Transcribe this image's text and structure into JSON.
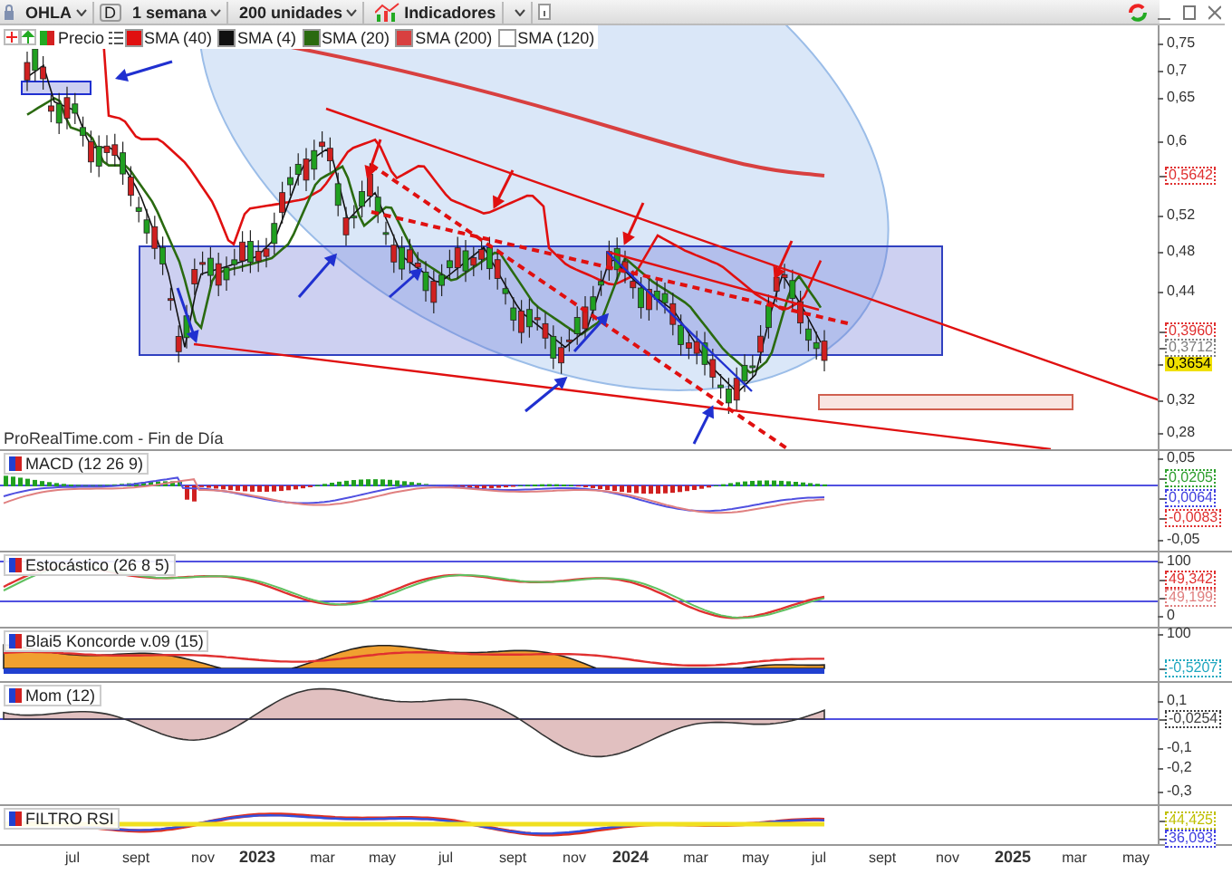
{
  "toolbar": {
    "symbol": "OHLA",
    "mode": "D",
    "period": "1 semana",
    "units": "200 unidades",
    "indicators": "Indicadores"
  },
  "legend": [
    {
      "label": "Precio",
      "color": "#d42020"
    },
    {
      "label": "SMA (40)",
      "color": "#e01010"
    },
    {
      "label": "SMA (4)",
      "color": "#101010"
    },
    {
      "label": "SMA (20)",
      "color": "#2a6a10"
    },
    {
      "label": "SMA (200)",
      "color": "#d84040"
    },
    {
      "label": "SMA (120)",
      "color": "#ffffff"
    }
  ],
  "price_panel": {
    "source": "ProRealTime.com - Fin de Día",
    "axis_labels": [
      {
        "text": "0,75",
        "kind": "tick"
      },
      {
        "text": "0,7",
        "kind": "tick"
      },
      {
        "text": "0,65",
        "kind": "tick"
      },
      {
        "text": "0,6",
        "kind": "tick"
      },
      {
        "text": "0,5642",
        "kind": "marker",
        "color": "#e03030"
      },
      {
        "text": "0,52",
        "kind": "tick"
      },
      {
        "text": "0,48",
        "kind": "tick"
      },
      {
        "text": "0,44",
        "kind": "tick"
      },
      {
        "text": "0,3960",
        "kind": "marker",
        "color": "#e03030"
      },
      {
        "text": "0,3712",
        "kind": "marker",
        "color": "#808080"
      },
      {
        "text": "0,3654",
        "kind": "current",
        "color": "#f0e000"
      },
      {
        "text": "0,32",
        "kind": "tick"
      },
      {
        "text": "0,28",
        "kind": "tick"
      }
    ]
  },
  "panels": [
    {
      "kind": "macd",
      "title": "MACD (12 26 9)",
      "axis_labels": [
        {
          "text": "0,05",
          "kind": "tick"
        },
        {
          "text": "0,0205",
          "kind": "marker",
          "color": "#30a030"
        },
        {
          "text": "0,0064",
          "kind": "marker",
          "color": "#4040e0"
        },
        {
          "text": "-0,0083",
          "kind": "marker",
          "color": "#e03030"
        },
        {
          "text": "-0,05",
          "kind": "tick"
        }
      ]
    },
    {
      "kind": "stochastic",
      "title": "Estocástico (26 8 5)",
      "axis_labels": [
        {
          "text": "100",
          "kind": "tick"
        },
        {
          "text": "49,342",
          "kind": "marker",
          "color": "#e03030"
        },
        {
          "text": "49,199",
          "kind": "marker",
          "color": "#e08080"
        },
        {
          "text": "0",
          "kind": "tick"
        }
      ]
    },
    {
      "kind": "koncorde",
      "title": "Blai5 Koncorde v.09 (15)",
      "axis_labels": [
        {
          "text": "100",
          "kind": "tick"
        },
        {
          "text": "-0,5207",
          "kind": "marker",
          "color": "#20a8c0"
        }
      ]
    },
    {
      "kind": "momentum",
      "title": "Mom (12)",
      "axis_labels": [
        {
          "text": "0,1",
          "kind": "tick"
        },
        {
          "text": "-0,0254",
          "kind": "marker",
          "color": "#404040"
        },
        {
          "text": "-0,1",
          "kind": "tick"
        },
        {
          "text": "-0,2",
          "kind": "tick"
        },
        {
          "text": "-0,3",
          "kind": "tick"
        }
      ]
    },
    {
      "kind": "rsi",
      "title": "FILTRO RSI",
      "axis_labels": [
        {
          "text": "44,425",
          "kind": "marker",
          "color": "#c0c000"
        },
        {
          "text": "36,093",
          "kind": "marker",
          "color": "#4040e0"
        }
      ]
    }
  ],
  "time_axis": [
    {
      "label": "jul",
      "kind": "month"
    },
    {
      "label": "sept",
      "kind": "month"
    },
    {
      "label": "nov",
      "kind": "month"
    },
    {
      "label": "2023",
      "kind": "year"
    },
    {
      "label": "mar",
      "kind": "month"
    },
    {
      "label": "may",
      "kind": "month"
    },
    {
      "label": "jul",
      "kind": "month"
    },
    {
      "label": "sept",
      "kind": "month"
    },
    {
      "label": "nov",
      "kind": "month"
    },
    {
      "label": "2024",
      "kind": "year"
    },
    {
      "label": "mar",
      "kind": "month"
    },
    {
      "label": "may",
      "kind": "month"
    },
    {
      "label": "jul",
      "kind": "month"
    },
    {
      "label": "sept",
      "kind": "month"
    },
    {
      "label": "nov",
      "kind": "month"
    },
    {
      "label": "2025",
      "kind": "year"
    },
    {
      "label": "mar",
      "kind": "month"
    },
    {
      "label": "may",
      "kind": "month"
    }
  ]
}
